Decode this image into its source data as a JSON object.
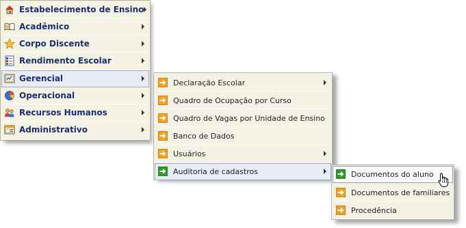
{
  "main_menu": {
    "items": [
      {
        "label": "Estabelecimento de Ensino",
        "icon": "house-icon"
      },
      {
        "label": "Acadêmico",
        "icon": "book-icon"
      },
      {
        "label": "Corpo Discente",
        "icon": "star-icon"
      },
      {
        "label": "Rendimento Escolar",
        "icon": "report-card-icon"
      },
      {
        "label": "Gerencial",
        "icon": "chart-document-icon"
      },
      {
        "label": "Operacional",
        "icon": "pie-chart-icon"
      },
      {
        "label": "Recursos Humanos",
        "icon": "people-icon"
      },
      {
        "label": "Administrativo",
        "icon": "admin-window-icon"
      }
    ]
  },
  "submenu_gerencial": {
    "items": [
      {
        "label": "Declaração Escolar",
        "has_submenu": true
      },
      {
        "label": "Quadro de Ocupação por Curso",
        "has_submenu": false
      },
      {
        "label": "Quadro de Vagas por Unidade de Ensino",
        "has_submenu": false
      },
      {
        "label": "Banco de Dados",
        "has_submenu": false
      },
      {
        "label": "Usuários",
        "has_submenu": true
      },
      {
        "label": "Auditoria de cadastros",
        "has_submenu": true
      }
    ]
  },
  "submenu_auditoria": {
    "items": [
      {
        "label": "Documentos do aluno"
      },
      {
        "label": "Documentos de familiares"
      },
      {
        "label": "Procedência"
      }
    ]
  },
  "colors": {
    "menu_bg": "#f4f2e4",
    "main_label": "#1d2f6e",
    "highlight": "#e7ebf4",
    "arrow_orange": "#f0a01c",
    "arrow_green": "#2f9a2a"
  }
}
